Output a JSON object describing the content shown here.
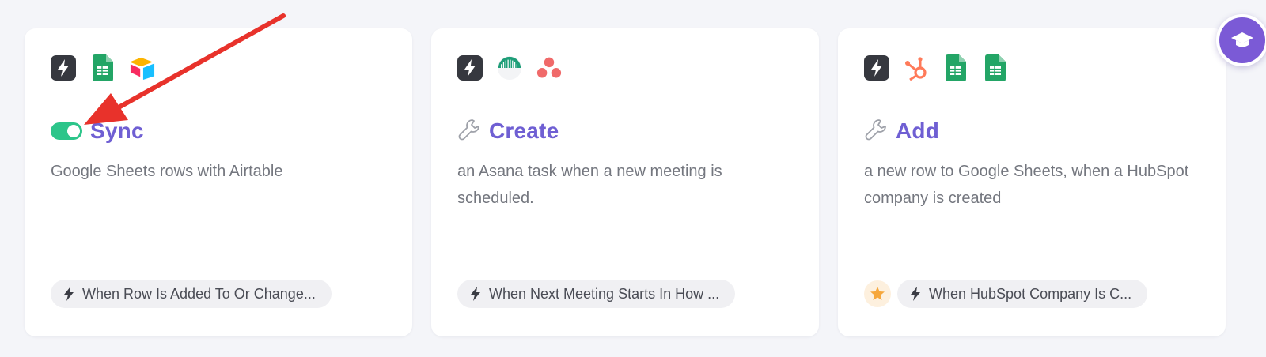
{
  "cards": [
    {
      "title": "Sync",
      "description": "Google Sheets rows with Airtable",
      "status_toggle": "on",
      "apps": [
        "zap-trigger-icon",
        "google-sheets-icon",
        "airtable-icon"
      ],
      "trigger_label": "When Row Is Added To Or Change..."
    },
    {
      "title": "Create",
      "description": "an Asana task when a new meeting is scheduled.",
      "apps": [
        "zap-trigger-icon",
        "calendar-app-icon",
        "asana-icon"
      ],
      "trigger_label": "When Next Meeting Starts In How ..."
    },
    {
      "title": "Add",
      "description": "a new row to Google Sheets, when a HubSpot company is created",
      "apps": [
        "zap-trigger-icon",
        "hubspot-icon",
        "google-sheets-icon",
        "google-sheets-icon"
      ],
      "trigger_label": "When HubSpot Company Is C..."
    }
  ],
  "colors": {
    "title": "#6f5fd3",
    "toggle_on": "#2cc58a",
    "annotation_arrow": "#e8322b",
    "learn_button": "#7b5ad6"
  }
}
